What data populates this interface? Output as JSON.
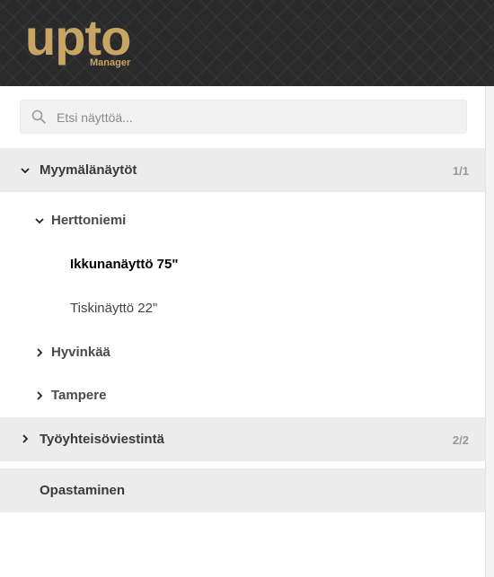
{
  "brand": {
    "name": "upto",
    "sub": "Manager",
    "color": "#c9a563"
  },
  "search": {
    "placeholder": "Etsi näyttöä...",
    "value": ""
  },
  "tree": {
    "myymalanaytot": {
      "label": "Myymälänäytöt",
      "count": "1/1",
      "expanded": true,
      "icon": "chevron-down-icon"
    },
    "herttoniemi": {
      "label": "Herttoniemi",
      "expanded": true,
      "icon": "chevron-down-icon"
    },
    "ikkunanaytto": {
      "label": "Ikkunanäyttö 75\"",
      "selected": true
    },
    "tiskinaytto": {
      "label": "Tiskinäyttö 22\""
    },
    "hyvinkaa": {
      "label": "Hyvinkää",
      "expanded": false,
      "icon": "chevron-right-icon"
    },
    "tampere": {
      "label": "Tampere",
      "expanded": false,
      "icon": "chevron-right-icon"
    },
    "tyoyhteisoviestinta": {
      "label": "Työyhteisöviestintä",
      "count": "2/2",
      "expanded": false,
      "icon": "chevron-right-icon"
    },
    "opastaminen": {
      "label": "Opastaminen"
    }
  }
}
